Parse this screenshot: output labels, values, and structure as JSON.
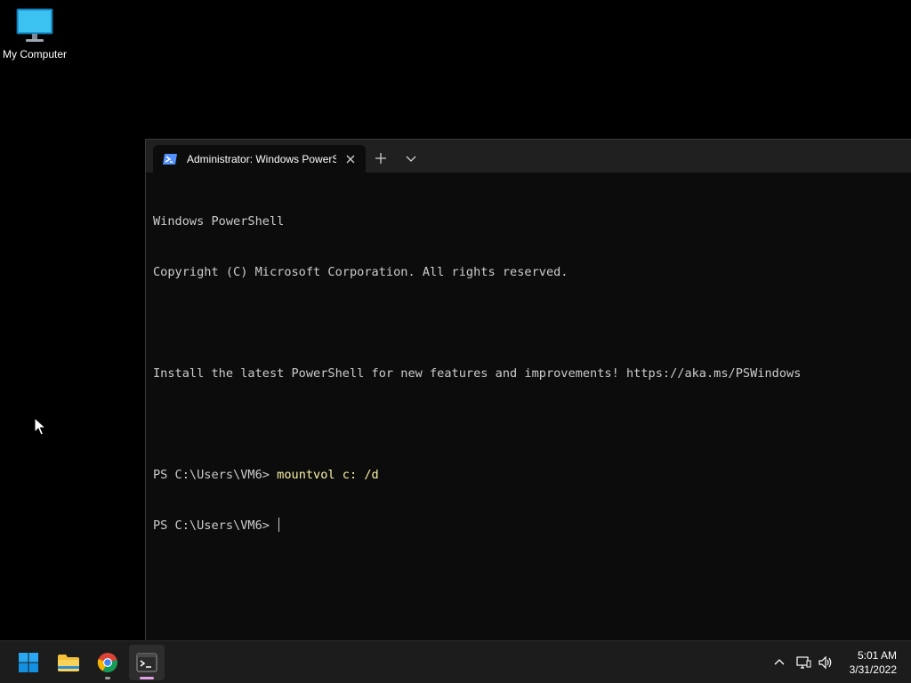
{
  "desktop": {
    "icons": [
      {
        "label": "My Computer",
        "icon": "monitor-icon"
      }
    ]
  },
  "terminal": {
    "tab_title": "Administrator: Windows PowerShell",
    "accent": "#0c0c0c",
    "lines": [
      {
        "prompt": "Windows PowerShell",
        "command": ""
      },
      {
        "prompt": "Copyright (C) Microsoft Corporation. All rights reserved.",
        "command": ""
      },
      {
        "prompt": "",
        "command": ""
      },
      {
        "prompt": "Install the latest PowerShell for new features and improvements! https://aka.ms/PSWindows",
        "command": ""
      },
      {
        "prompt": "",
        "command": ""
      },
      {
        "prompt": "PS C:\\Users\\VM6> ",
        "command": "mountvol c: /d"
      },
      {
        "prompt": "PS C:\\Users\\VM6> ",
        "command": ""
      }
    ]
  },
  "taskbar": {
    "apps": [
      {
        "name": "Start",
        "icon": "windows-start-icon"
      },
      {
        "name": "File Explorer",
        "icon": "folder-icon"
      },
      {
        "name": "Google Chrome",
        "icon": "chrome-icon"
      },
      {
        "name": "Windows Terminal",
        "icon": "terminal-icon"
      }
    ],
    "tray": {
      "time": "5:01 AM",
      "date": "3/31/2022"
    }
  }
}
